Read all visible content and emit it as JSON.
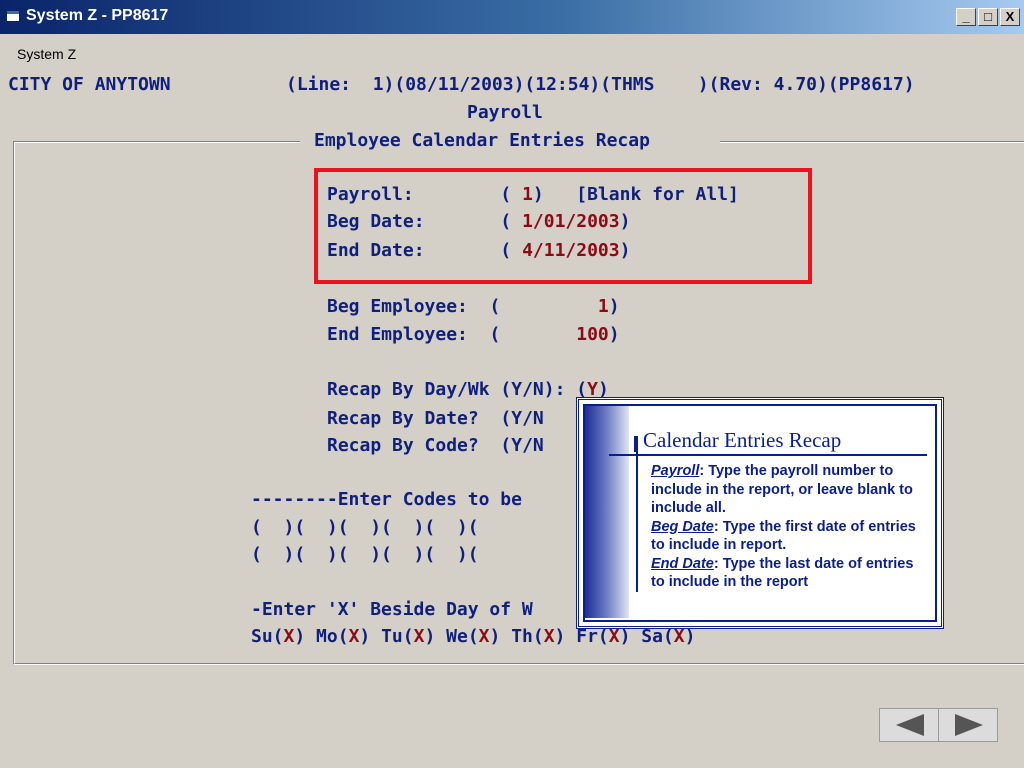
{
  "window": {
    "title": "System Z - PP8617",
    "min_label": "_",
    "max_label": "□",
    "close_label": "X"
  },
  "menu": {
    "system_z": "System Z"
  },
  "header": {
    "line1_left": "CITY OF ANYTOWN",
    "line1_right": "(Line:  1)(08/11/2003)(12:54)(THMS    )(Rev: 4.70)(PP8617)",
    "line2": "Payroll",
    "line3": "Employee Calendar Entries Recap"
  },
  "fields": {
    "payroll_label": "Payroll:        (",
    "payroll_value": " 1",
    "payroll_hint": ")   [Blank for All]",
    "beg_date_label": "Beg Date:       (",
    "beg_date_value": " 1/01/2003",
    "beg_date_close": ")",
    "end_date_label": "End Date:       (",
    "end_date_value": " 4/11/2003",
    "end_date_close": ")",
    "beg_emp_label": "Beg Employee:  (",
    "beg_emp_value": "         1",
    "beg_emp_close": ")",
    "end_emp_label": "End Employee:  (",
    "end_emp_value": "       100",
    "end_emp_close": ")",
    "recap_day_label": "Recap By Day/Wk (Y/N): (",
    "recap_day_value": "Y",
    "recap_day_close": ")",
    "recap_date_label": "Recap By Date?  (Y/N",
    "recap_code_label": "Recap By Code?  (Y/N",
    "codes_heading": "--------Enter Codes to be",
    "codes_row1": "(  )(  )(  )(  )(  )(",
    "codes_row2": "(  )(  )(  )(  )(  )(",
    "days_heading": "-Enter 'X' Beside Day of W",
    "days": [
      {
        "label": "Su(",
        "value": "X",
        "close": ") "
      },
      {
        "label": "Mo(",
        "value": "X",
        "close": ") "
      },
      {
        "label": "Tu(",
        "value": "X",
        "close": ") "
      },
      {
        "label": "We(",
        "value": "X",
        "close": ") "
      },
      {
        "label": "Th(",
        "value": "X",
        "close": ") "
      },
      {
        "label": "Fr(",
        "value": "X",
        "close": ") "
      },
      {
        "label": "Sa(",
        "value": "X",
        "close": ")"
      }
    ]
  },
  "callout": {
    "title": "Calendar Entries Recap",
    "items": [
      {
        "term": "Payroll",
        "text": ":  Type the payroll number to include in the report, or leave blank to include all."
      },
      {
        "term": "Beg Date",
        "text": ":  Type the first date of entries to include in report."
      },
      {
        "term": "End Date",
        "text": ":  Type the last date of entries to include in the report"
      }
    ]
  },
  "nav": {
    "prev_icon": "triangle-left-icon",
    "next_icon": "triangle-right-icon"
  },
  "colors": {
    "terminal_text": "#0f1f7c",
    "input_value": "#8b0a16",
    "highlight_border": "#e8131c",
    "window_bg": "#d4d0c8"
  }
}
